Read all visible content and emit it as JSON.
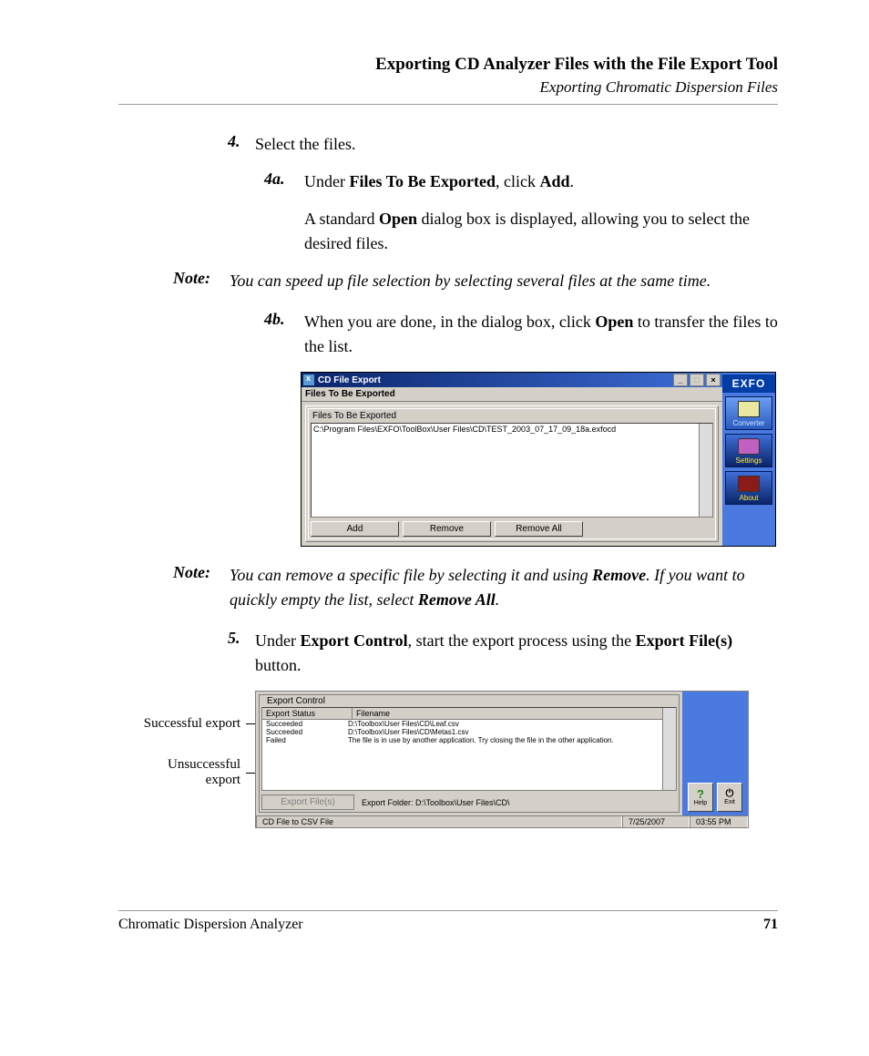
{
  "header": {
    "title": "Exporting CD Analyzer Files with the File Export Tool",
    "subtitle": "Exporting Chromatic Dispersion Files"
  },
  "steps": {
    "s4": {
      "num": "4.",
      "text": "Select the files."
    },
    "s4a": {
      "num": "4a.",
      "pre": "Under ",
      "b1": "Files To Be Exported",
      "mid": ", click ",
      "b2": "Add",
      "post": "."
    },
    "s4a_para": {
      "pre": "A standard ",
      "b1": "Open",
      "post": " dialog box is displayed, allowing you to select the desired files."
    },
    "s4b": {
      "num": "4b.",
      "pre": "When you are done, in the dialog box, click ",
      "b1": "Open",
      "post": " to transfer the files to the list."
    },
    "s5": {
      "num": "5.",
      "pre": "Under ",
      "b1": "Export Control",
      "mid": ", start the export process using the ",
      "b2": "Export File(s)",
      "post": " button."
    }
  },
  "notes": {
    "label": "Note:",
    "n1": "You can speed up file selection by selecting several files at the same time.",
    "n2": {
      "pre": "You can remove a specific file by selecting it and using ",
      "b1": "Remove",
      "mid": ". If you want to quickly empty the list, select ",
      "b2": "Remove All",
      "post": "."
    }
  },
  "win1": {
    "title": "CD File Export",
    "section": "Files To Be Exported",
    "group": "Files To Be Exported",
    "list_item": "C:\\Program Files\\EXFO\\ToolBox\\User Files\\CD\\TEST_2003_07_17_09_18a.exfocd",
    "btn_add": "Add",
    "btn_remove": "Remove",
    "btn_removeall": "Remove All",
    "brand": "EXFO",
    "side_converter": "Converter",
    "side_settings": "Settings",
    "side_about": "About"
  },
  "callouts": {
    "success": "Successful export",
    "fail_l1": "Unsuccessful",
    "fail_l2": "export"
  },
  "win2": {
    "group": "Export Control",
    "col_status": "Export Status",
    "col_file": "Filename",
    "rows": [
      {
        "status": "Succeeded",
        "file": "D:\\Toolbox\\User Files\\CD\\Leaf.csv"
      },
      {
        "status": "Succeeded",
        "file": "D:\\Toolbox\\User Files\\CD\\Metas1.csv"
      },
      {
        "status": "Failed",
        "file": "The file is in use by another application. Try closing the file in the other application."
      }
    ],
    "export_btn": "Export File(s)",
    "folder": "Export Folder: D:\\Toolbox\\User Files\\CD\\",
    "help": "Help",
    "exit": "Exit",
    "status_main": "CD File to CSV File",
    "status_date": "7/25/2007",
    "status_time": "03:55 PM"
  },
  "footer": {
    "product": "Chromatic Dispersion Analyzer",
    "page": "71"
  }
}
